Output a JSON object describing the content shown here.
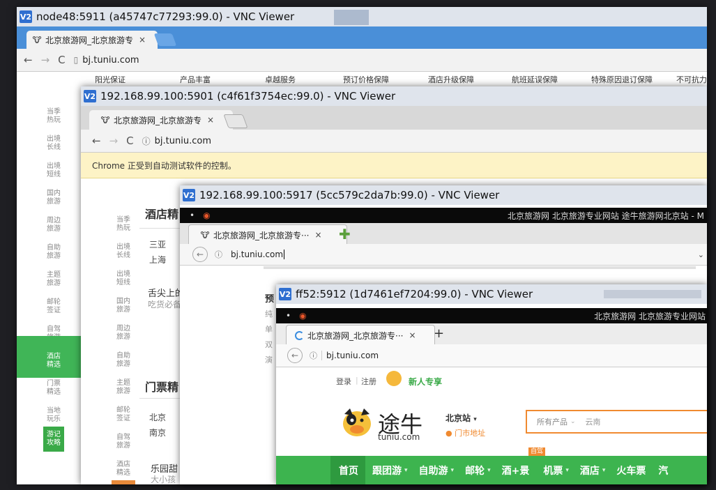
{
  "windows": {
    "w1": {
      "vnc_title": "node48:5911 (a45747c77293:99.0) - VNC Viewer",
      "tab_title": "北京旅游网_北京旅游专",
      "url": "bj.tuniu.com",
      "strip": [
        "阳光保证",
        "产品丰富",
        "卓越服务",
        "预订价格保障",
        "酒店升级保障",
        "航班延误保障",
        "特殊原因退订保障",
        "不可抗力"
      ],
      "sidebar": [
        "当季\n热玩",
        "出境\n长线",
        "出境\n短线",
        "国内\n旅游",
        "周边\n旅游",
        "自助\n旅游",
        "主题\n旅游",
        "邮轮\n签证",
        "自驾\n旅游",
        "酒店\n精选",
        "门票\n精选",
        "当地\n玩乐",
        "游记\n攻略"
      ]
    },
    "w2": {
      "vnc_title": "192.168.99.100:5901 (c4f61f3754ec:99.0) - VNC Viewer",
      "tab_title": "北京旅游网_北京旅游专",
      "url": "bj.tuniu.com",
      "infobar": "Chrome 正受到自动测试软件的控制。",
      "sidebar": [
        "当季\n热玩",
        "出境\n长线",
        "出境\n短线",
        "国内\n旅游",
        "周边\n旅游",
        "自助\n旅游",
        "主题\n旅游",
        "邮轮\n签证",
        "自驾\n旅游",
        "酒店\n精选"
      ],
      "hotel_heading": "酒店精",
      "hotel_cities": [
        "三亚",
        "上海"
      ],
      "food_title": "舌尖上的",
      "food_sub": "吃货必备",
      "ticket_heading": "门票精",
      "ticket_cities": [
        "北京",
        "南京"
      ],
      "park_title": "乐园甜",
      "park_sub": "大小孩"
    },
    "w3": {
      "vnc_title": "192.168.99.100:5917 (5cc579c2da7b:99.0) - VNC Viewer",
      "os_title": "北京旅游网 北京旅游专业网站 途牛旅游网北京站 - M",
      "tab_title": "北京旅游网_北京旅游专···",
      "url": "bj.tuniu.com",
      "content": [
        "预",
        "纯",
        "单",
        "双",
        "演"
      ]
    },
    "w4": {
      "vnc_title": "ff52:5912 (1d7461ef7204:99.0) - VNC Viewer",
      "os_title": "北京旅游网 北京旅游专业网站",
      "tab_title": "北京旅游网_北京旅游专···",
      "url": "bj.tuniu.com",
      "login": "登录",
      "register": "注册",
      "new_user": "新人专享",
      "logo_cn": "途牛",
      "logo_en": "tuniu.com",
      "city": "北京站",
      "store": "门市地址",
      "search_scope": "所有产品",
      "search_value": "云南",
      "badge": "自驾",
      "nav": [
        "首页",
        "跟团游",
        "自助游",
        "邮轮",
        "酒+景",
        "机票",
        "酒店",
        "火车票",
        "汽"
      ]
    }
  }
}
